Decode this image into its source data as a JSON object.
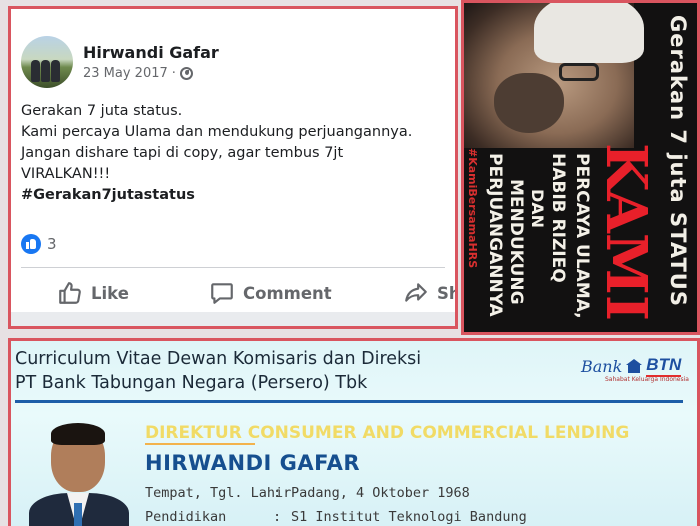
{
  "facebook_post": {
    "author": "Hirwandi Gafar",
    "date": "23 May 2017",
    "meta_separator": "·",
    "privacy_icon": "globe-icon",
    "lines": [
      "Gerakan 7 juta status.",
      "Kami percaya Ulama dan mendukung perjuangannya.",
      "Jangan dishare tapi di copy, agar tembus 7jt",
      "VIRALKAN!!!"
    ],
    "hashtag": "#Gerakan7jutastatus",
    "reaction_count": "3",
    "actions": {
      "like": "Like",
      "comment": "Comment",
      "share": "Sh"
    },
    "colors": {
      "like_blue": "#1877f2",
      "text": "#1c1e21",
      "muted": "#65676b"
    }
  },
  "poster": {
    "top_text": "Gerakan 7 juta STATUS",
    "headline": "KAMI",
    "line1": "PERCAYA ULAMA,",
    "line2": "HABIB RIZIEQ",
    "line3": "DAN",
    "line4": "MENDUKUNG",
    "line5": "PERJUANGANNYA",
    "watermark": "#KamiBersamaHRS",
    "colors": {
      "headline": "#e8202a",
      "background": "#121111"
    }
  },
  "cv": {
    "title": "Curriculum Vitae Dewan Komisaris dan Direksi",
    "subtitle": "PT Bank Tabungan Negara (Persero) Tbk",
    "bank_word": "Bank",
    "bank_brand": "BTN",
    "bank_tagline": "Sahabat Keluarga Indonesia",
    "position": "DIREKTUR CONSUMER AND COMMERCIAL LENDING",
    "name": "HIRWANDI GAFAR",
    "rows": [
      {
        "label": "Tempat, Tgl. Lahir",
        "sep": ":",
        "value": "Padang, 4 Oktober 1968"
      },
      {
        "label": "Pendidikan",
        "sep": ":",
        "value": "S1 Institut Teknologi Bandung"
      }
    ],
    "colors": {
      "name": "#164f8f",
      "position": "#f3d64d",
      "rule": "#1d5ea8"
    }
  },
  "frame_color": "#d9555f"
}
